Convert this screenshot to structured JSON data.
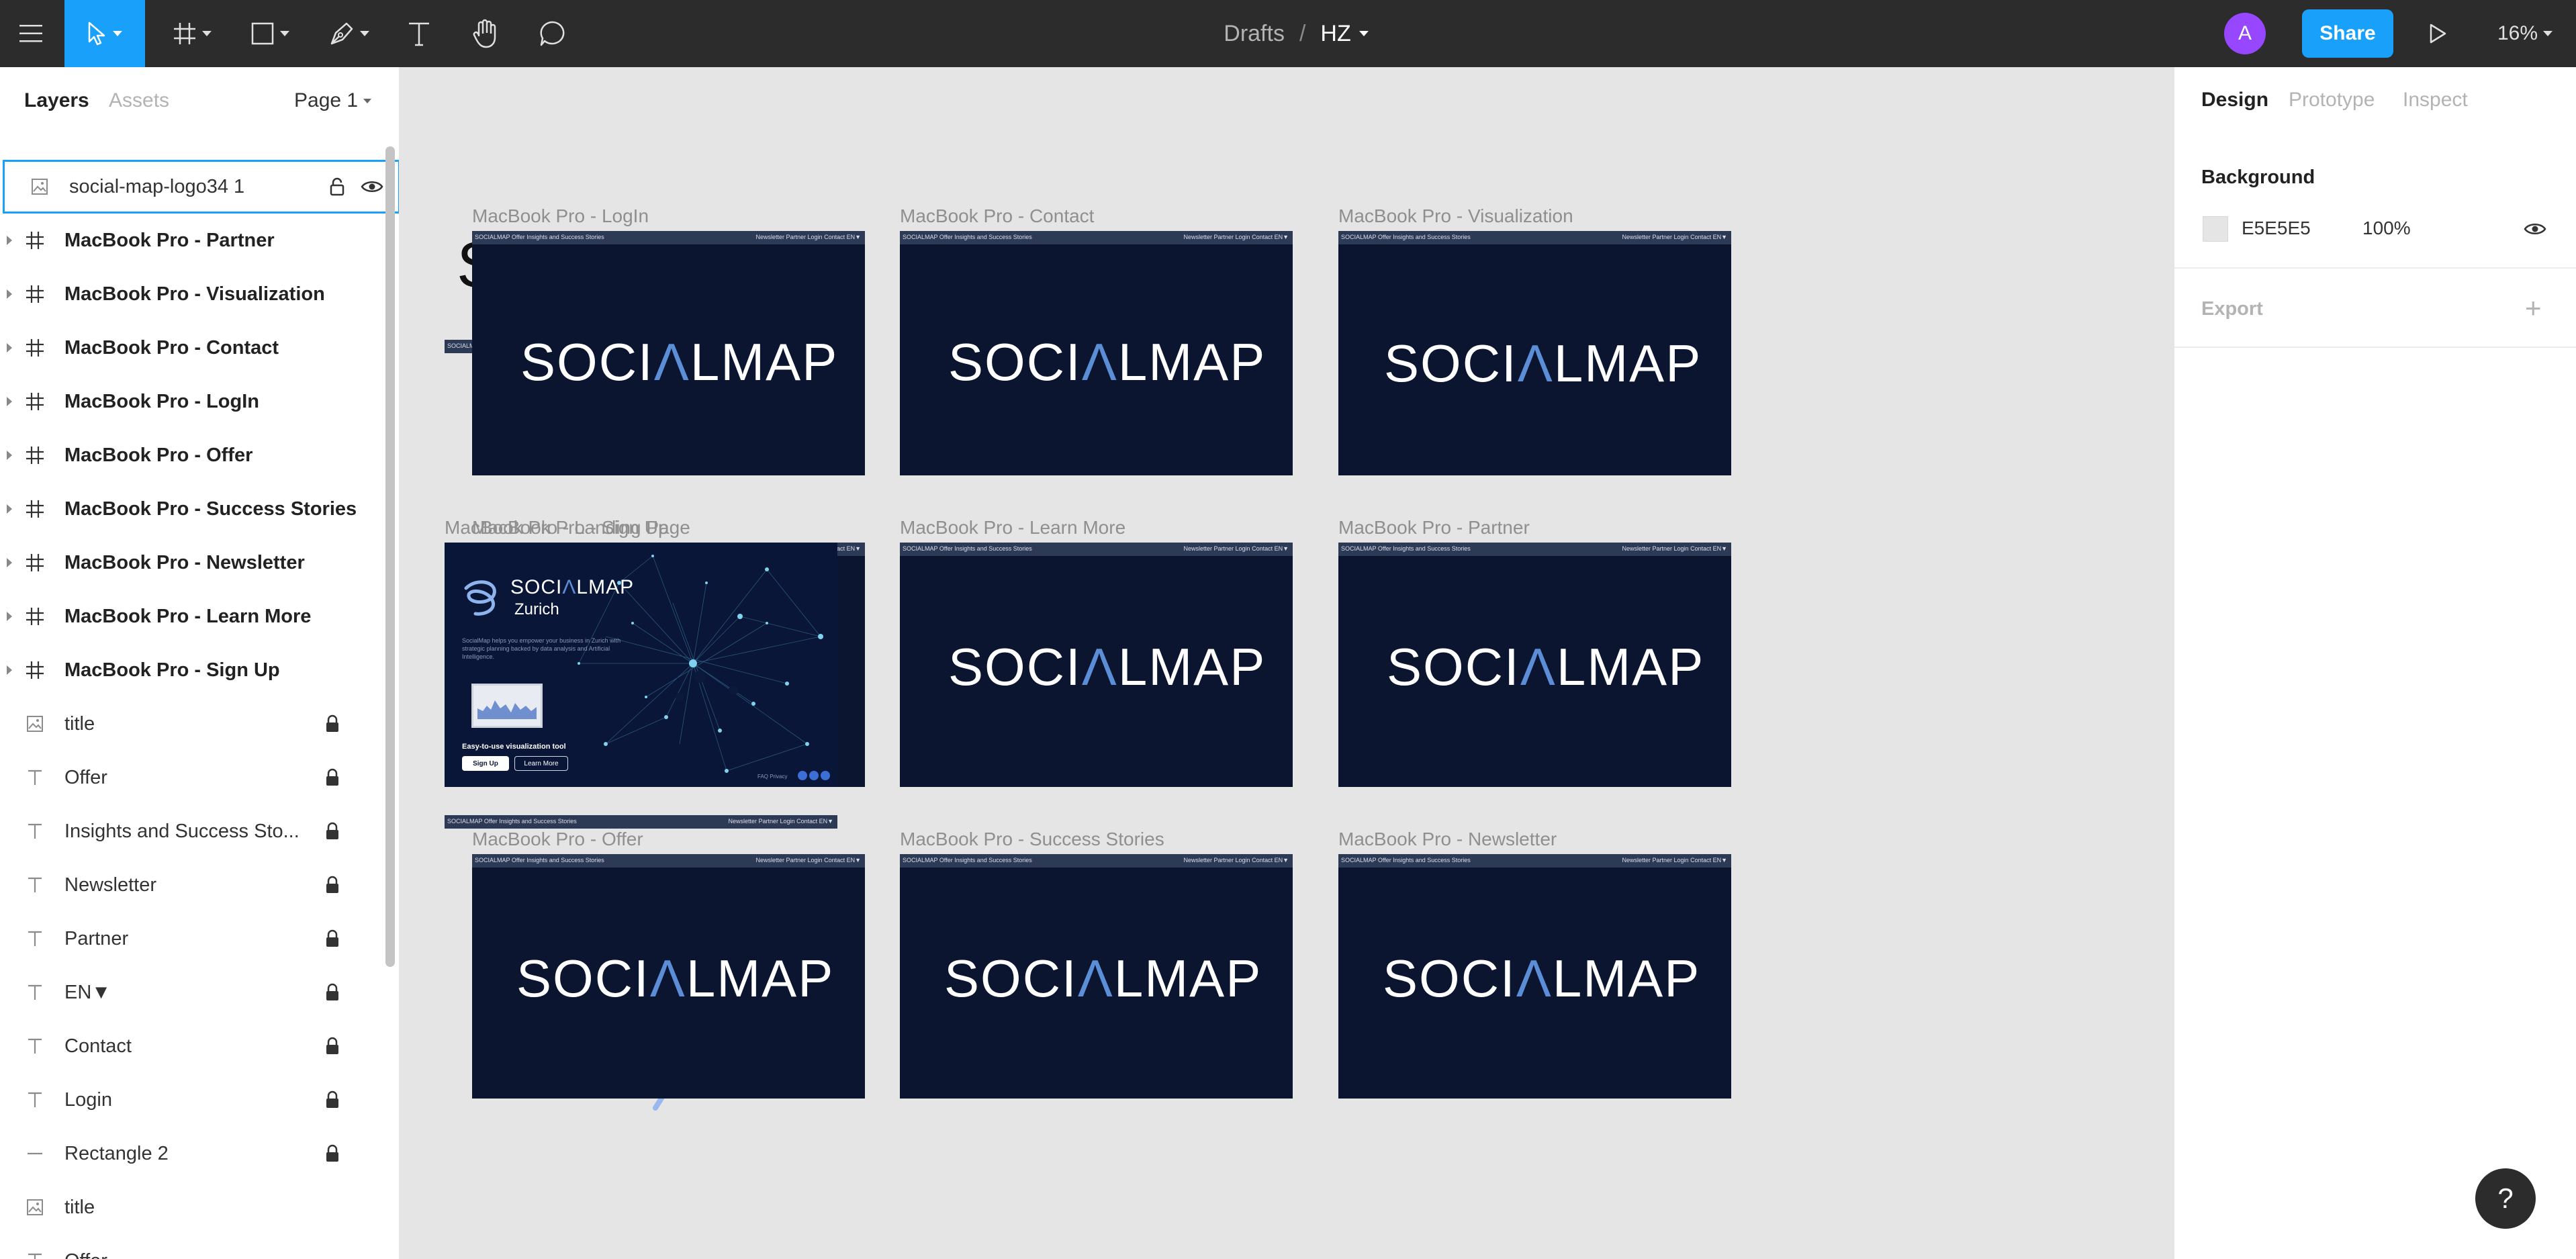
{
  "toolbar": {
    "breadcrumb_folder": "Drafts",
    "breadcrumb_sep": "/",
    "file_name": "HZ",
    "avatar_initial": "A",
    "share_label": "Share",
    "zoom": "16%"
  },
  "left_panel": {
    "tab_layers": "Layers",
    "tab_assets": "Assets",
    "page": "Page 1",
    "layers": [
      {
        "name": "social-map-logo34 1",
        "icon": "image-icon",
        "selected": true,
        "expandable": false,
        "locked": false
      },
      {
        "name": "MacBook Pro -  Partner",
        "icon": "frame-icon",
        "expandable": true,
        "locked": false
      },
      {
        "name": "MacBook Pro -  Visualization",
        "icon": "frame-icon",
        "expandable": true,
        "locked": false
      },
      {
        "name": "MacBook Pro - Contact",
        "icon": "frame-icon",
        "expandable": true,
        "locked": false
      },
      {
        "name": "MacBook Pro - LogIn",
        "icon": "frame-icon",
        "expandable": true,
        "locked": false
      },
      {
        "name": "MacBook Pro - Offer",
        "icon": "frame-icon",
        "expandable": true,
        "locked": false
      },
      {
        "name": "MacBook Pro - Success Stories",
        "icon": "frame-icon",
        "expandable": true,
        "locked": false
      },
      {
        "name": "MacBook Pro - Newsletter",
        "icon": "frame-icon",
        "expandable": true,
        "locked": false
      },
      {
        "name": "MacBook Pro - Learn More",
        "icon": "frame-icon",
        "expandable": true,
        "locked": false
      },
      {
        "name": "MacBook Pro - Sign Up",
        "icon": "frame-icon",
        "expandable": true,
        "locked": false
      },
      {
        "name": "title",
        "icon": "image-icon",
        "expandable": false,
        "locked": true
      },
      {
        "name": "Offer",
        "icon": "text-icon",
        "expandable": false,
        "locked": true
      },
      {
        "name": "Insights and Success Sto...",
        "icon": "text-icon",
        "expandable": false,
        "locked": true
      },
      {
        "name": "Newsletter",
        "icon": "text-icon",
        "expandable": false,
        "locked": true
      },
      {
        "name": "Partner",
        "icon": "text-icon",
        "expandable": false,
        "locked": true
      },
      {
        "name": "EN▼",
        "icon": "text-icon",
        "expandable": false,
        "locked": true
      },
      {
        "name": "Contact",
        "icon": "text-icon",
        "expandable": false,
        "locked": true
      },
      {
        "name": "Login",
        "icon": "text-icon",
        "expandable": false,
        "locked": true
      },
      {
        "name": "Rectangle 2",
        "icon": "line-icon",
        "expandable": false,
        "locked": true
      },
      {
        "name": "title",
        "icon": "image-icon",
        "expandable": false,
        "locked": false
      },
      {
        "name": "Offer",
        "icon": "text-icon",
        "expandable": false,
        "locked": false
      }
    ]
  },
  "canvas": {
    "logo_text_pre": "SOCI",
    "logo_text_accent": "Λ",
    "logo_text_post": "LMAP",
    "nav_left": "SOCIALMAP  Offer   Insights and Success Stories",
    "nav_right": "Newsletter  Partner  Login  Contact  EN▼",
    "frames": [
      {
        "label": "MacBook Pro - LogIn"
      },
      {
        "label": "MacBook Pro - Contact"
      },
      {
        "label": "MacBook Pro -  Visualization"
      },
      {
        "label": "MacBook Pro - Landing Page"
      },
      {
        "label": "MacBook Pro - Sign Up"
      },
      {
        "label": "MacBook Pro - Learn More"
      },
      {
        "label": "MacBook Pro -  Partner"
      },
      {
        "label": "MacBook Pro - Offer"
      },
      {
        "label": "MacBook Pro - Success Stories"
      },
      {
        "label": "MacBook Pro - Newsletter"
      }
    ],
    "landing": {
      "city": "Zurich",
      "tagline": "SocialMap helps you empower your business in Zurich with strategic planning backed by data analysis and Artificial Intelligence.",
      "cta_title": "Easy-to-use visualization tool",
      "signup_btn": "Sign Up",
      "learn_btn": "Learn More",
      "footer": "FAQ   Privacy"
    }
  },
  "right_panel": {
    "tab_design": "Design",
    "tab_prototype": "Prototype",
    "tab_inspect": "Inspect",
    "background_title": "Background",
    "background_hex": "E5E5E5",
    "background_opacity": "100%",
    "export_title": "Export",
    "export_add": "+"
  },
  "help_label": "?"
}
